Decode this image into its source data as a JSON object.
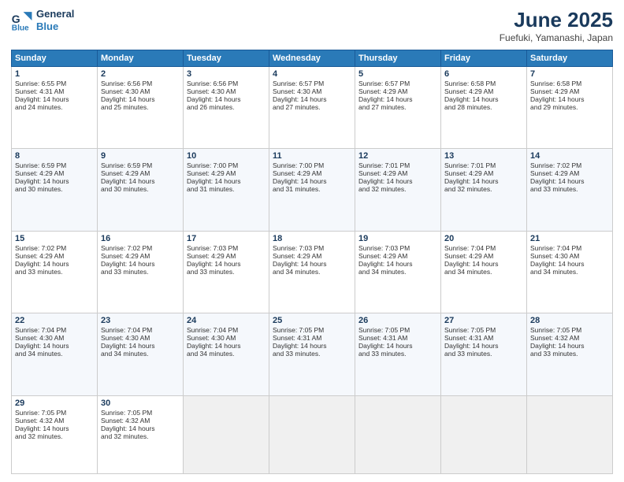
{
  "logo": {
    "line1": "General",
    "line2": "Blue"
  },
  "title": "June 2025",
  "subtitle": "Fuefuki, Yamanashi, Japan",
  "weekdays": [
    "Sunday",
    "Monday",
    "Tuesday",
    "Wednesday",
    "Thursday",
    "Friday",
    "Saturday"
  ],
  "weeks": [
    [
      {
        "day": "1",
        "sunrise": "6:55 PM",
        "sunset": "4:31 AM",
        "daylight": "14 hours and 24 minutes."
      },
      {
        "day": "2",
        "sunrise": "6:56 PM",
        "sunset": "4:30 AM",
        "daylight": "14 hours and 25 minutes."
      },
      {
        "day": "3",
        "sunrise": "6:56 PM",
        "sunset": "4:30 AM",
        "daylight": "14 hours and 26 minutes."
      },
      {
        "day": "4",
        "sunrise": "6:57 PM",
        "sunset": "4:30 AM",
        "daylight": "14 hours and 27 minutes."
      },
      {
        "day": "5",
        "sunrise": "6:57 PM",
        "sunset": "4:29 AM",
        "daylight": "14 hours and 27 minutes."
      },
      {
        "day": "6",
        "sunrise": "6:58 PM",
        "sunset": "4:29 AM",
        "daylight": "14 hours and 28 minutes."
      },
      {
        "day": "7",
        "sunrise": "6:58 PM",
        "sunset": "4:29 AM",
        "daylight": "14 hours and 29 minutes."
      }
    ],
    [
      {
        "day": "8",
        "sunrise": "6:59 PM",
        "sunset": "4:29 AM",
        "daylight": "14 hours and 30 minutes."
      },
      {
        "day": "9",
        "sunrise": "6:59 PM",
        "sunset": "4:29 AM",
        "daylight": "14 hours and 30 minutes."
      },
      {
        "day": "10",
        "sunrise": "7:00 PM",
        "sunset": "4:29 AM",
        "daylight": "14 hours and 31 minutes."
      },
      {
        "day": "11",
        "sunrise": "7:00 PM",
        "sunset": "4:29 AM",
        "daylight": "14 hours and 31 minutes."
      },
      {
        "day": "12",
        "sunrise": "7:01 PM",
        "sunset": "4:29 AM",
        "daylight": "14 hours and 32 minutes."
      },
      {
        "day": "13",
        "sunrise": "7:01 PM",
        "sunset": "4:29 AM",
        "daylight": "14 hours and 32 minutes."
      },
      {
        "day": "14",
        "sunrise": "7:02 PM",
        "sunset": "4:29 AM",
        "daylight": "14 hours and 33 minutes."
      }
    ],
    [
      {
        "day": "15",
        "sunrise": "7:02 PM",
        "sunset": "4:29 AM",
        "daylight": "14 hours and 33 minutes."
      },
      {
        "day": "16",
        "sunrise": "7:02 PM",
        "sunset": "4:29 AM",
        "daylight": "14 hours and 33 minutes."
      },
      {
        "day": "17",
        "sunrise": "7:03 PM",
        "sunset": "4:29 AM",
        "daylight": "14 hours and 33 minutes."
      },
      {
        "day": "18",
        "sunrise": "7:03 PM",
        "sunset": "4:29 AM",
        "daylight": "14 hours and 34 minutes."
      },
      {
        "day": "19",
        "sunrise": "7:03 PM",
        "sunset": "4:29 AM",
        "daylight": "14 hours and 34 minutes."
      },
      {
        "day": "20",
        "sunrise": "7:04 PM",
        "sunset": "4:29 AM",
        "daylight": "14 hours and 34 minutes."
      },
      {
        "day": "21",
        "sunrise": "7:04 PM",
        "sunset": "4:30 AM",
        "daylight": "14 hours and 34 minutes."
      }
    ],
    [
      {
        "day": "22",
        "sunrise": "7:04 PM",
        "sunset": "4:30 AM",
        "daylight": "14 hours and 34 minutes."
      },
      {
        "day": "23",
        "sunrise": "7:04 PM",
        "sunset": "4:30 AM",
        "daylight": "14 hours and 34 minutes."
      },
      {
        "day": "24",
        "sunrise": "7:04 PM",
        "sunset": "4:30 AM",
        "daylight": "14 hours and 34 minutes."
      },
      {
        "day": "25",
        "sunrise": "7:05 PM",
        "sunset": "4:31 AM",
        "daylight": "14 hours and 33 minutes."
      },
      {
        "day": "26",
        "sunrise": "7:05 PM",
        "sunset": "4:31 AM",
        "daylight": "14 hours and 33 minutes."
      },
      {
        "day": "27",
        "sunrise": "7:05 PM",
        "sunset": "4:31 AM",
        "daylight": "14 hours and 33 minutes."
      },
      {
        "day": "28",
        "sunrise": "7:05 PM",
        "sunset": "4:32 AM",
        "daylight": "14 hours and 33 minutes."
      }
    ],
    [
      {
        "day": "29",
        "sunrise": "7:05 PM",
        "sunset": "4:32 AM",
        "daylight": "14 hours and 32 minutes."
      },
      {
        "day": "30",
        "sunrise": "7:05 PM",
        "sunset": "4:32 AM",
        "daylight": "14 hours and 32 minutes."
      },
      null,
      null,
      null,
      null,
      null
    ]
  ],
  "sunrise_label": "Sunrise:",
  "sunset_label": "Sunset:",
  "daylight_label": "Daylight:"
}
